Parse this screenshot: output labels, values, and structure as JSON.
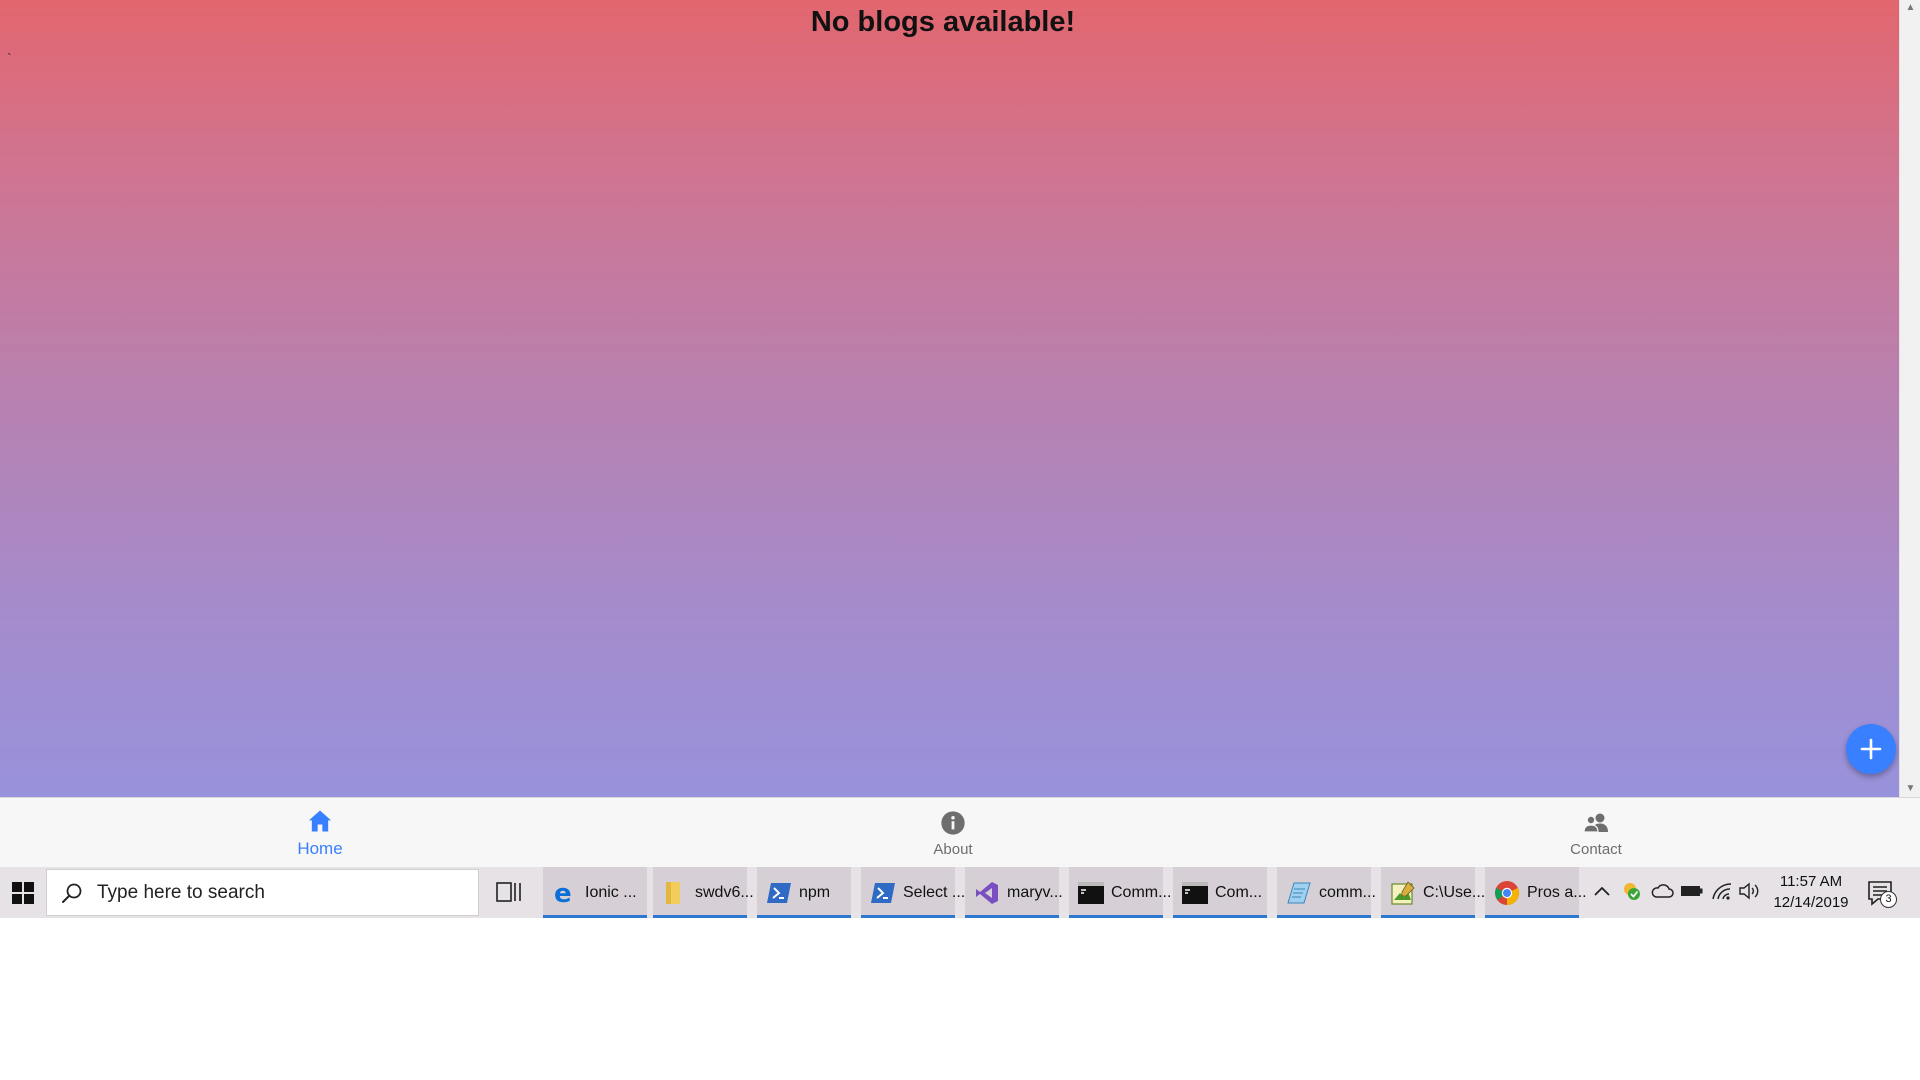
{
  "app": {
    "title": "No blogs available!",
    "stray_mark": "`"
  },
  "tabs": [
    {
      "label": "Home",
      "icon": "home-icon",
      "active": true
    },
    {
      "label": "About",
      "icon": "info-icon",
      "active": false
    },
    {
      "label": "Contact",
      "icon": "people-icon",
      "active": false
    }
  ],
  "fab": {
    "icon": "add-icon"
  },
  "taskbar": {
    "search_placeholder": "Type here to search",
    "items": [
      {
        "label": "Ionic ...",
        "icon": "edge-icon"
      },
      {
        "label": "swdv6...",
        "icon": "folder-icon"
      },
      {
        "label": "npm",
        "icon": "powershell-icon"
      },
      {
        "label": "Select ...",
        "icon": "powershell-icon"
      },
      {
        "label": "maryv...",
        "icon": "visual-studio-icon"
      },
      {
        "label": "Comm...",
        "icon": "command-prompt-icon"
      },
      {
        "label": "Com...",
        "icon": "command-prompt-icon"
      },
      {
        "label": "comm...",
        "icon": "notepad-icon"
      },
      {
        "label": "C:\\Use...",
        "icon": "image-editor-icon"
      },
      {
        "label": "Pros a...",
        "icon": "chrome-icon"
      }
    ],
    "clock_time": "11:57 AM",
    "clock_date": "12/14/2019",
    "notification_count": "3"
  },
  "colors": {
    "accent": "#3880ff",
    "gradient_top": "#e2666e",
    "gradient_bottom": "#9892dc",
    "taskbar_underline": "#2a78d0"
  }
}
